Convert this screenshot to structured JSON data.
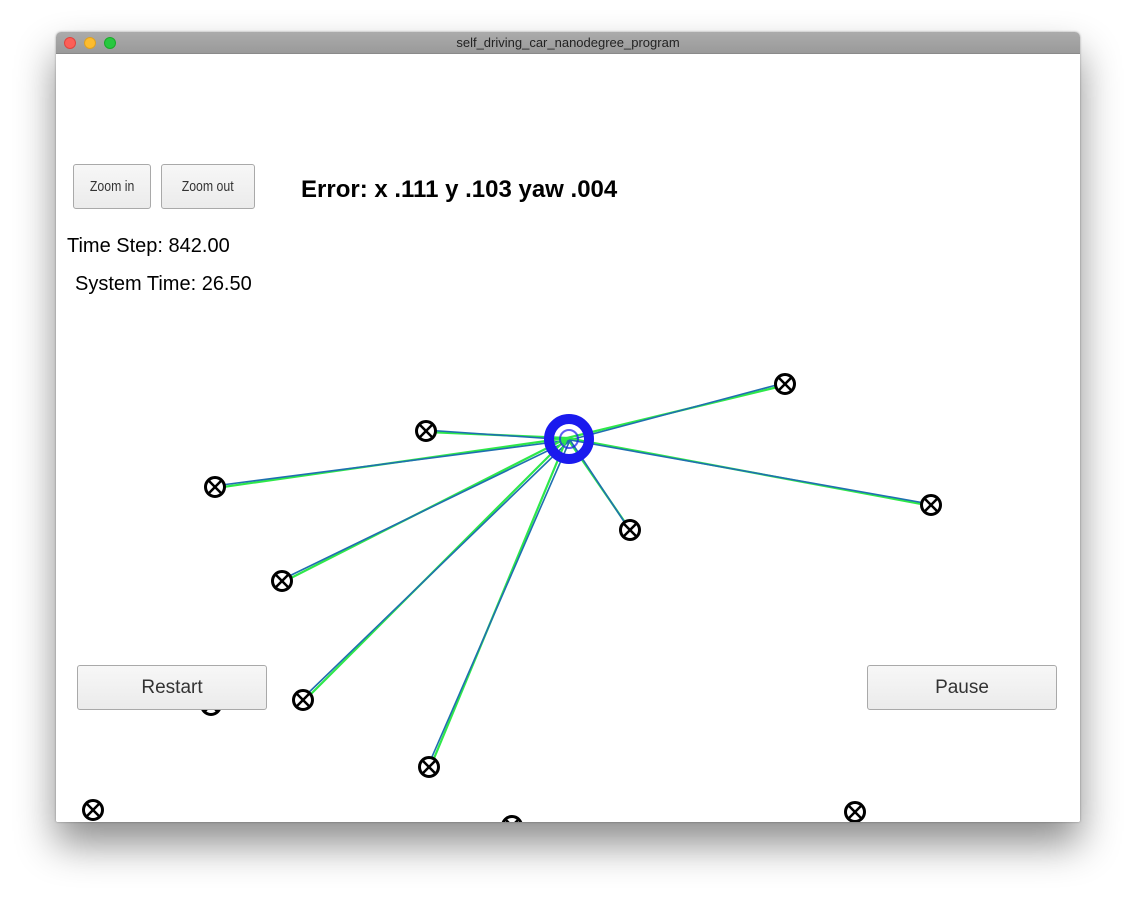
{
  "window": {
    "title": "self_driving_car_nanodegree_program"
  },
  "controls": {
    "zoom_in_label": "Zoom in",
    "zoom_out_label": "Zoom out",
    "restart_label": "Restart",
    "pause_label": "Pause"
  },
  "hud": {
    "error_text": "Error: x .111 y .103 yaw .004",
    "time_step_text": "Time Step: 842.00",
    "system_time_text": "System Time: 26.50"
  },
  "colors": {
    "vehicle": "#1a1aee",
    "landmark": "#000000",
    "observation_line_green": "#2ee84a",
    "observation_line_blue": "#1f6fb0",
    "button_border": "#a9a9a9"
  },
  "icons": {
    "landmark": "circled-x-marker",
    "vehicle": "blue-ring-marker"
  }
}
